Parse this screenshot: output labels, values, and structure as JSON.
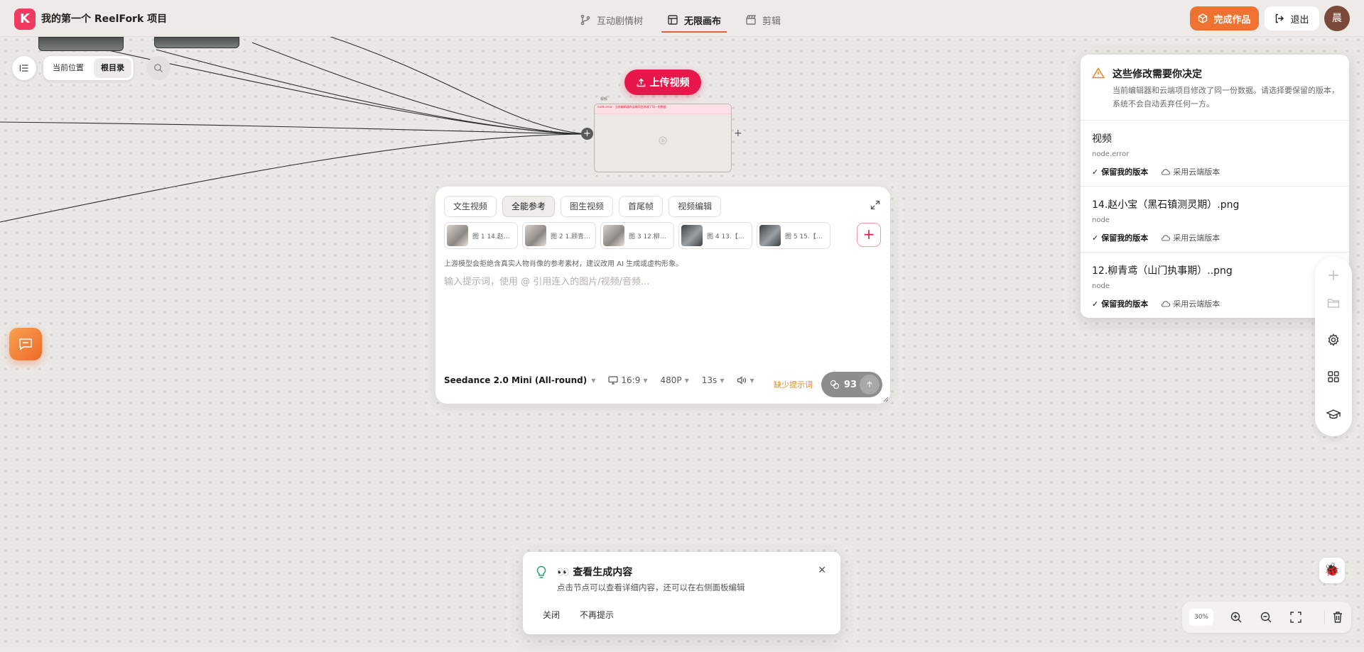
{
  "app": {
    "logo_letter": "K",
    "project_title": "我的第一个 ReelFork 项目",
    "brand_color": "#ef3b62",
    "accent_color": "#ee7330"
  },
  "topnav": {
    "tabs": [
      {
        "label": "互动剧情树",
        "icon": "branch-icon",
        "active": false
      },
      {
        "label": "无限画布",
        "icon": "canvas-icon",
        "active": true
      },
      {
        "label": "剪辑",
        "icon": "clapper-icon",
        "active": false
      }
    ]
  },
  "header_actions": {
    "finish_label": "完成作品",
    "exit_label": "退出",
    "avatar_initial": "晨"
  },
  "breadcrumb": {
    "current_label": "当前位置",
    "root_label": "根目录"
  },
  "canvas": {
    "upload_label": "上传视频",
    "node_caption": "视频",
    "node_error_text": "node.error · 当前编辑器和云端项目修改了同一份数据"
  },
  "composer": {
    "modes": [
      "文生视频",
      "全能参考",
      "图生视频",
      "首尾帧",
      "视频编辑"
    ],
    "active_mode": "全能参考",
    "refs": [
      {
        "label": "图 1 14.赵…",
        "dark": false
      },
      {
        "label": "图 2 1.顾青…",
        "dark": false
      },
      {
        "label": "图 3 12.柳…",
        "dark": false
      },
      {
        "label": "图 4 13.【…",
        "dark": true
      },
      {
        "label": "图 5 15.【…",
        "dark": true
      }
    ],
    "warning_note": "上游模型会拒绝含真实人物肖像的参考素材，建议改用 AI 生成或虚构形象。",
    "prompt_placeholder": "输入提示词，使用 @ 引用连入的图片/视频/音频...",
    "model_label": "Seedance 2.0 Mini (All-round)",
    "aspect_label": "16:9",
    "resolution_label": "480P",
    "duration_label": "13s",
    "missing_prompt_label": "缺少提示词",
    "credits_value": "93"
  },
  "conflict_panel": {
    "title": "这些修改需要你决定",
    "description": "当前编辑器和云端项目修改了同一份数据。请选择要保留的版本，系统不会自动丢弃任何一方。",
    "items": [
      {
        "title": "视频",
        "sub": "node.error",
        "keep_label": "保留我的版本",
        "cloud_label": "采用云端版本"
      },
      {
        "title": "14.赵小宝（黑石镇测灵期）.png",
        "sub": "node",
        "keep_label": "保留我的版本",
        "cloud_label": "采用云端版本"
      },
      {
        "title": "12.柳青鸢（山门执事期）..png",
        "sub": "node",
        "keep_label": "保留我的版本",
        "cloud_label": "采用云端版本"
      }
    ]
  },
  "right_toolbar": {
    "icons": [
      "plus-icon",
      "folder-icon",
      "gear-icon",
      "grid-icon",
      "graduation-cap-icon"
    ]
  },
  "zoom": {
    "percent_label": "30%"
  },
  "tip": {
    "emoji": "👀",
    "title": "查看生成内容",
    "description": "点击节点可以查看详细内容，还可以在右侧面板编辑",
    "close_label": "关闭",
    "dismiss_label": "不再提示"
  }
}
